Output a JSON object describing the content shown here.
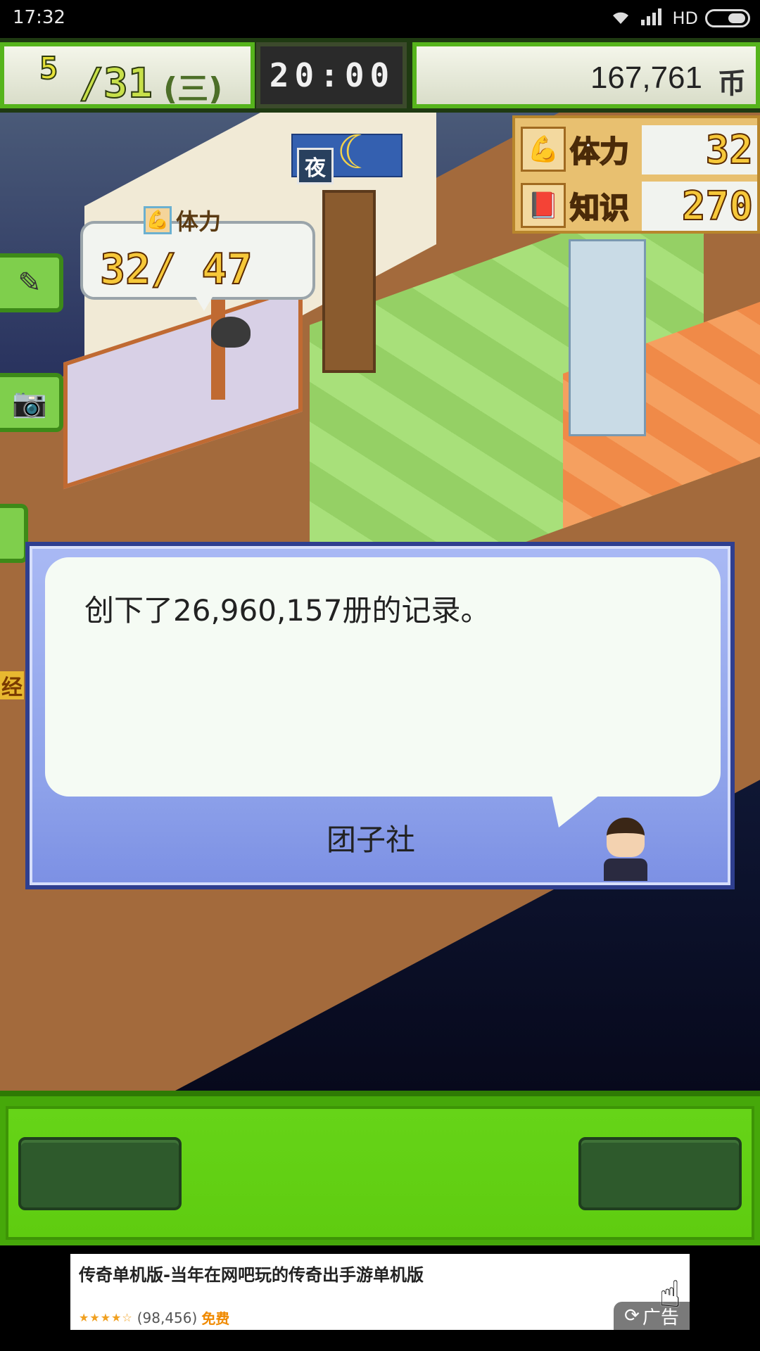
{
  "status_bar": {
    "time": "17:32",
    "network": "HD",
    "icons": [
      "wifi-icon",
      "signal-icon",
      "battery-icon"
    ]
  },
  "hud": {
    "month": "5",
    "day": "/31",
    "weekday": "(三)",
    "clock": "20:00",
    "money": "167,761",
    "money_unit": "币"
  },
  "scene": {
    "time_of_day": "夜",
    "stamina_bubble": {
      "label": "体力",
      "value": "32/ 47"
    }
  },
  "stats": {
    "stamina_label": "体力",
    "stamina_value": "32",
    "knowledge_label": "知识",
    "knowledge_value": "270"
  },
  "side_buttons": {
    "label_char": "经"
  },
  "dialog": {
    "message": "创下了26,960,157册的记录。",
    "speaker": "团子社"
  },
  "ad": {
    "title": "传奇单机版-当年在网吧玩的传奇出手游单机版",
    "stars": "★★★★☆",
    "reviews": "(98,456)",
    "price": "免费",
    "badge": "广告"
  },
  "colors": {
    "hud_green": "#56b41c",
    "dialog_blue": "#8ea2ea",
    "bottom_green": "#5fcc10",
    "night_sky": "#111a3a"
  }
}
